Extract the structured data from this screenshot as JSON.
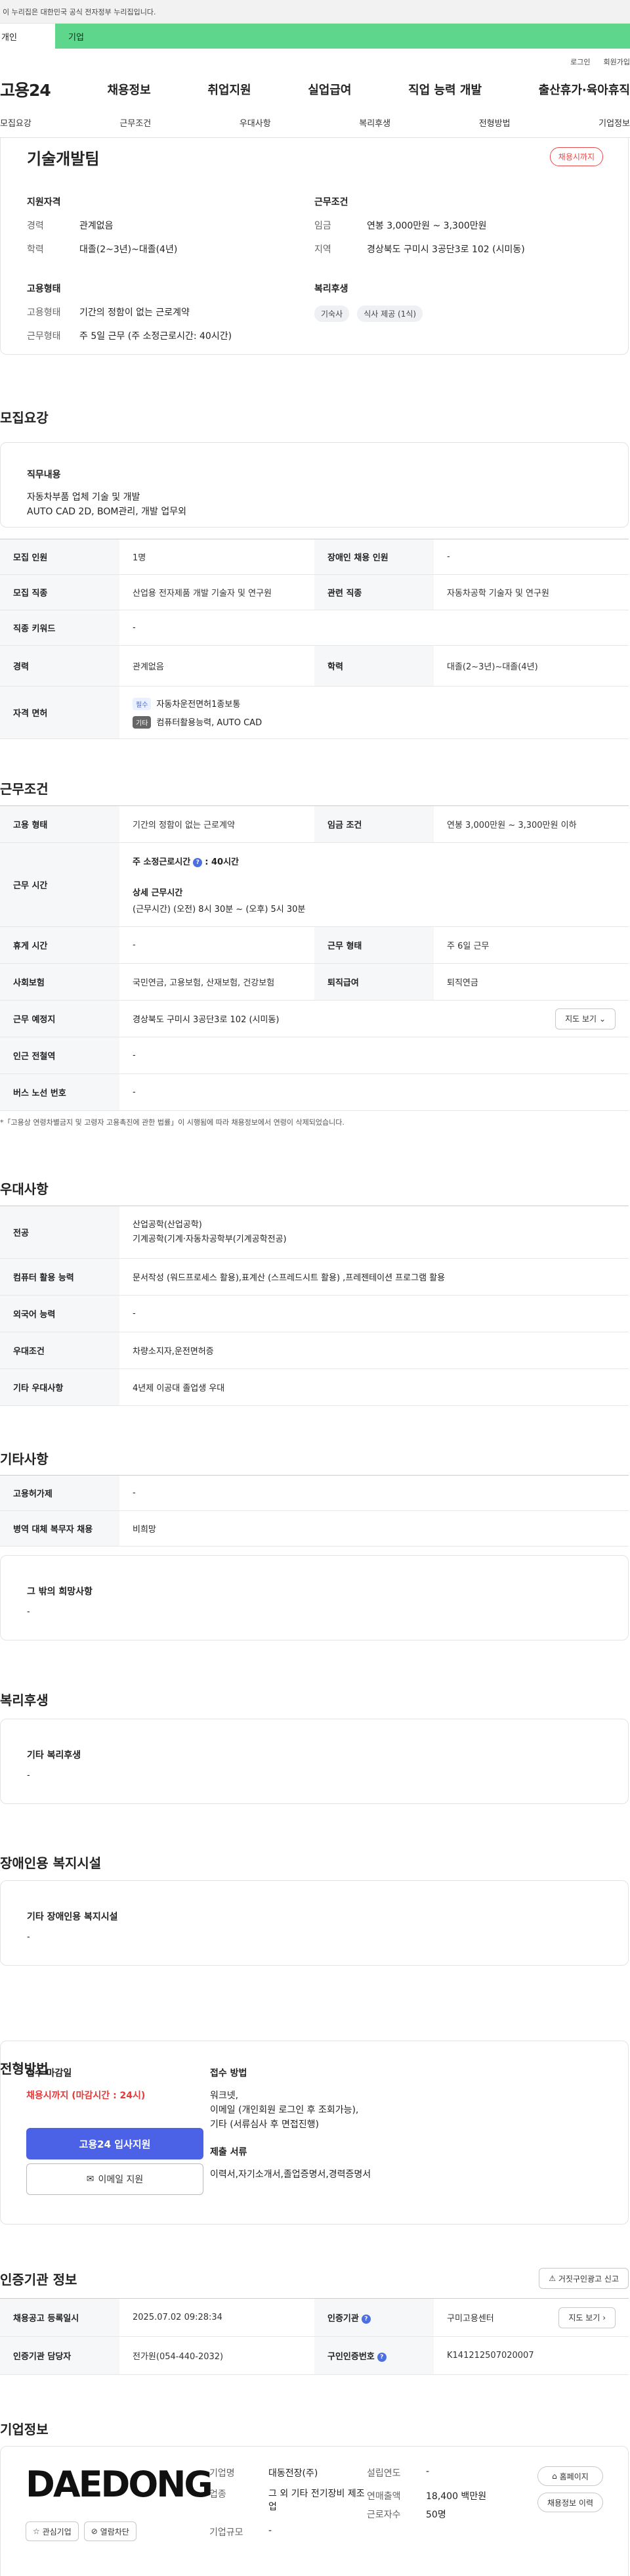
{
  "gov_banner": "이 누리집은 대한민국 공식 전자정부 누리집입니다.",
  "user_tabs": [
    "개인",
    "기업"
  ],
  "util_links": [
    "로그인",
    "회원가입"
  ],
  "logo": "고용24",
  "gnb": [
    "채용정보",
    "취업지원",
    "실업급여",
    "직업 능력 개발",
    "출산휴가·육아휴직"
  ],
  "subnav": [
    "모집요강",
    "근무조건",
    "우대사항",
    "복리후생",
    "전형방법",
    "기업정보"
  ],
  "summary": {
    "title": "기술개발팀",
    "status_chip": "채용시까지",
    "qual_title": "지원자격",
    "qual_rows": [
      {
        "k": "경력",
        "v": "관계없음"
      },
      {
        "k": "학력",
        "v": "대졸(2~3년)~대졸(4년)"
      }
    ],
    "emp_title": "고용형태",
    "emp_rows": [
      {
        "k": "고용형태",
        "v": "기간의 정함이 없는 근로계약"
      },
      {
        "k": "근무형태",
        "v": "주 5일 근무 (주 소정근로시간: 40시간)"
      }
    ],
    "cond_title": "근무조건",
    "cond_rows": [
      {
        "k": "임금",
        "v": "연봉 3,000만원 ~ 3,300만원"
      },
      {
        "k": "지역",
        "v": "경상북도 구미시 3공단3로 102 (시미동)"
      }
    ],
    "welfare_title": "복리후생",
    "welfare_pills": [
      "기숙사",
      "식사 제공 (1식)"
    ]
  },
  "recruit": {
    "title": "모집요강",
    "duty_title": "직무내용",
    "duty_lines": [
      "자동차부품 업체 기술 및 개발",
      "AUTO CAD 2D, BOM관리, 개발 업무외"
    ],
    "rows": [
      {
        "k1": "모집 인원",
        "v1": "1명",
        "k2": "장애인 채용 인원",
        "v2": "-"
      },
      {
        "k1": "모집 직종",
        "v1": "산업용 전자제품 개발 기술자 및 연구원",
        "k2": "관련 직종",
        "v2": "자동차공학 기술자 및 연구원"
      },
      {
        "k1": "직종 키워드",
        "v1": "-"
      },
      {
        "k1": "경력",
        "v1": "관계없음",
        "k2": "학력",
        "v2": "대졸(2~3년)~대졸(4년)"
      }
    ],
    "license_key": "자격 면허",
    "license_req_badge": "필수",
    "license_req": "자동차운전면허1종보통",
    "license_opt_badge": "기타",
    "license_opt": "컴퓨터활용능력, AUTO CAD"
  },
  "work": {
    "title": "근무조건",
    "emp_key": "고용 형태",
    "emp_val": "기간의 정함이 없는 근로계약",
    "wage_key": "임금 조건",
    "wage_val": "연봉 3,000만원 ~ 3,300만원 이하",
    "hours_key": "근무 시간",
    "hours_week": "주 소정근로시간",
    "hours_week_val": ": 40시간",
    "hours_detail_title": "상세 근무시간",
    "hours_detail": "(근무시간) (오전) 8시 30분 ~ (오후) 5시 30분",
    "rest_key": "휴게 시간",
    "rest_val": "-",
    "type_key": "근무 형태",
    "type_val": "주 6일 근무",
    "ins_key": "사회보험",
    "ins_val": "국민연금, 고용보험, 산재보험, 건강보험",
    "ret_key": "퇴직급여",
    "ret_val": "퇴직연금",
    "place_key": "근무 예정지",
    "place_val": "경상북도 구미시 3공단3로 102 (시미동)",
    "map_btn": "지도 보기",
    "station_key": "인근 전철역",
    "station_val": "-",
    "bus_key": "버스 노선 번호",
    "bus_val": "-",
    "note": "*「고용상 연령차별금지 및 고령자 고용촉진에 관한 법률」이 시행됨에 따라 채용정보에서 연령이 삭제되었습니다."
  },
  "pref": {
    "title": "우대사항",
    "rows": [
      {
        "k": "전공",
        "v": [
          "산업공학(산업공학)",
          "기계공학(기계·자동차공학부(기계공학전공)"
        ]
      },
      {
        "k": "컴퓨터 활용 능력",
        "v": [
          "문서작성 (워드프로세스 활용),표계산 (스프레드시트 활용) ,프레젠테이션 프로그램 활용"
        ]
      },
      {
        "k": "외국어 능력",
        "v": [
          "-"
        ]
      },
      {
        "k": "우대조건",
        "v": [
          "차량소지자,운전면허증"
        ]
      },
      {
        "k": "기타 우대사항",
        "v": [
          "4년제 이공대 졸업생 우대"
        ]
      }
    ]
  },
  "etc": {
    "title": "기타사항",
    "rows": [
      {
        "k": "고용허가제",
        "v": "-"
      },
      {
        "k": "병역 대체 복무자 채용",
        "v": "비희망"
      }
    ],
    "other_title": "그 밖의 희망사항",
    "other_val": "-"
  },
  "welfare": {
    "title": "복리후생",
    "box_title": "기타 복리후생",
    "box_val": "-"
  },
  "disabled": {
    "title": "장애인용 복지시설",
    "box_title": "기타 장애인용 복지시설",
    "box_val": "-"
  },
  "screening": {
    "title": "전형방법",
    "deadline_title": "접수 마감일",
    "deadline_val": "채용시까지 (마감시간 : 24시)",
    "apply_btn": "고용24 입사지원",
    "email_btn": "이메일 지원",
    "method_title": "접수 방법",
    "method_lines": [
      "워크넷,",
      "이메일 (개인회원 로그인 후 조회가능),",
      "기타 (서류심사 후 면접진행)"
    ],
    "docs_title": "제출 서류",
    "docs_val": "이력서,자기소개서,졸업증명서,경력증명서"
  },
  "cert": {
    "title": "인증기관 정보",
    "report_btn": "거짓구인광고 신고",
    "reg_key": "채용공고 등록일시",
    "reg_val": "2025.07.02 09:28:34",
    "org_key": "인증기관",
    "org_val": "구미고용센터",
    "map_btn": "지도 보기",
    "mgr_key": "인증기관 담당자",
    "mgr_val": "전가원(054-440-2032)",
    "no_key": "구인인증번호",
    "no_val": "K141212507020007"
  },
  "company": {
    "title": "기업정보",
    "logo_text": "DAEDONG",
    "fav_btn": "관심기업",
    "block_btn": "열람차단",
    "name_key": "기업명",
    "name_val": "대동전장(주)",
    "found_key": "설립연도",
    "found_val": "-",
    "ind_key": "업종",
    "ind_val": "그 외 기타 전기장비 제조업",
    "sales_key": "연매출액",
    "sales_val": "18,400 백만원",
    "emp_key": "근로자수",
    "emp_val": "50명",
    "size_key": "기업규모",
    "size_val": "-",
    "home_btn": "홈페이지",
    "history_btn": "채용정보 이력"
  },
  "colors": {
    "accent_green": "#5ed68b",
    "primary_blue": "#4c62e6",
    "alert_red": "#e63a3a"
  }
}
